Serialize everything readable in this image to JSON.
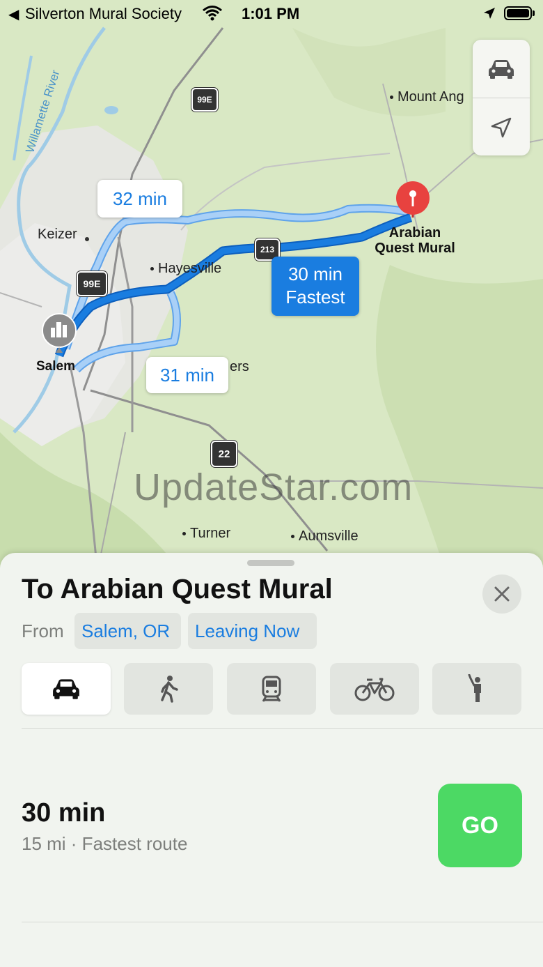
{
  "status_bar": {
    "back_glyph": "◀",
    "carrier": "Silverton Mural Society",
    "time": "1:01 PM"
  },
  "map": {
    "places": {
      "mount_angel": "Mount Ang",
      "keizer": "Keizer",
      "hayesville": "Hayesville",
      "salem": "Salem",
      "four_corners_partial": "ers",
      "turner": "Turner",
      "aumsville": "Aumsville",
      "destination": "Arabian Quest Mural",
      "river": "Willamette River"
    },
    "highways": {
      "h1": "99E",
      "h2": "99E",
      "h3": "213",
      "h4": "22"
    },
    "routes": {
      "alt_top": "32 min",
      "alt_bottom": "31 min",
      "selected_time": "30 min",
      "selected_tag": "Fastest"
    },
    "colors": {
      "route_selected": "#1a7de0",
      "route_alt": "#8ebff0",
      "pin": "#e8423f",
      "go": "#4cd964"
    }
  },
  "watermark": "UpdateStar.com",
  "directions": {
    "title": "To Arabian Quest Mural",
    "from_label": "From",
    "origin": "Salem, OR",
    "departure": "Leaving Now",
    "modes": [
      {
        "name": "drive",
        "icon": "car-icon",
        "active": true
      },
      {
        "name": "walk",
        "icon": "walking-icon",
        "active": false
      },
      {
        "name": "transit",
        "icon": "train-icon",
        "active": false
      },
      {
        "name": "cycle",
        "icon": "bicycle-icon",
        "active": false
      },
      {
        "name": "rideshare",
        "icon": "hailing-person-icon",
        "active": false
      }
    ],
    "route": {
      "duration": "30 min",
      "detail": "15 mi · Fastest route",
      "go_label": "GO"
    }
  }
}
